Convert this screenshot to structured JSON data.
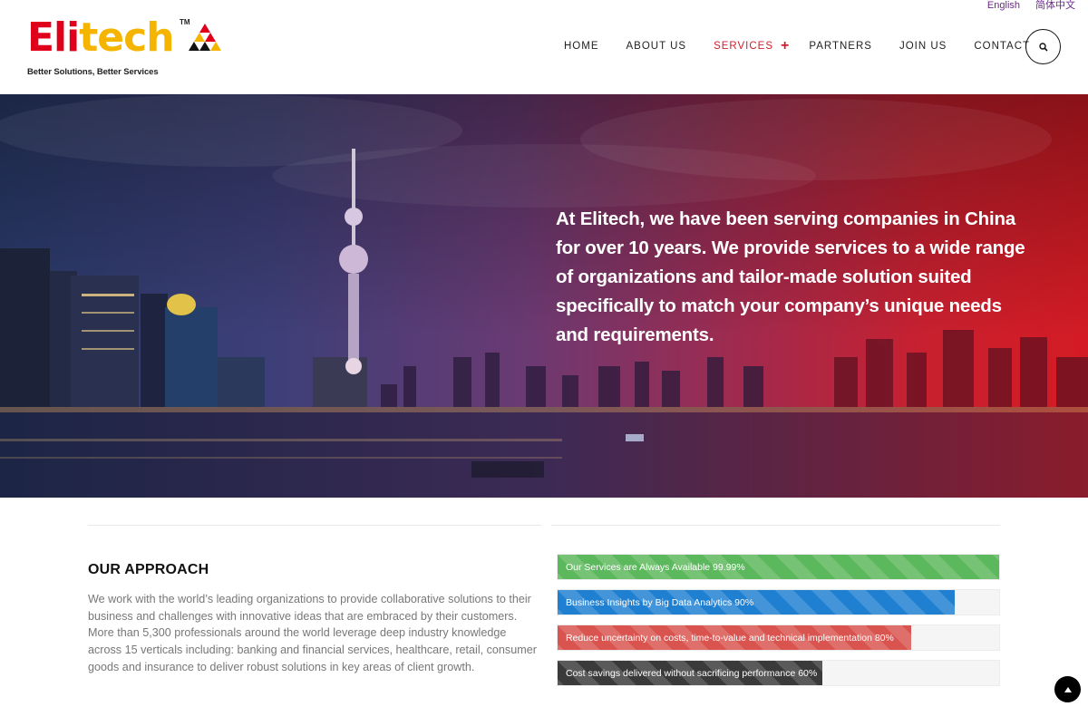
{
  "languages": [
    "English",
    "简体中文"
  ],
  "logo": {
    "name_part1": "Eli",
    "name_part2": "tech",
    "trademark": "TM",
    "tagline": "Better Solutions, Better Services"
  },
  "nav": {
    "items": [
      "HOME",
      "ABOUT US",
      "SERVICES",
      "PARTNERS",
      "JOIN US",
      "CONTACT"
    ],
    "active": "SERVICES",
    "expand_glyph": "+",
    "search_icon": "search-icon"
  },
  "hero": {
    "text": "At Elitech, we have been serving companies in China for over 10 years. We provide services to a wide range of organizations and tailor-made solution suited specifically to match your company’s unique needs and requirements."
  },
  "approach": {
    "title": "OUR APPROACH",
    "body": "We work with the world’s leading organizations to provide collaborative solutions to their business and challenges with innovative ideas that are embraced by their customers. More than 5,300 professionals around the world leverage deep industry knowledge across 15 verticals including: banking and financial services, healthcare, retail, consumer goods and insurance to deliver robust solutions in key areas of client growth."
  },
  "progress_bars": [
    {
      "label": "Our Services are Always Available 99.99%",
      "percent": 99.99,
      "color": "#5cb85c"
    },
    {
      "label": "Business Insights by Big Data Analytics 90%",
      "percent": 90,
      "color": "#1f7fd1"
    },
    {
      "label": "Reduce uncertainty on costs, time-to-value and technical implementation 80%",
      "percent": 80,
      "color": "#d9534f"
    },
    {
      "label": "Cost savings delivered without sacrificing performance 60%",
      "percent": 60,
      "color": "#3a3a3a"
    }
  ],
  "colors": {
    "accent": "#d21e2b",
    "language_link": "#6b2a8a",
    "logo_red": "#e0001b",
    "logo_yellow": "#f5b400"
  },
  "back_to_top_icon": "chevron-up-icon"
}
